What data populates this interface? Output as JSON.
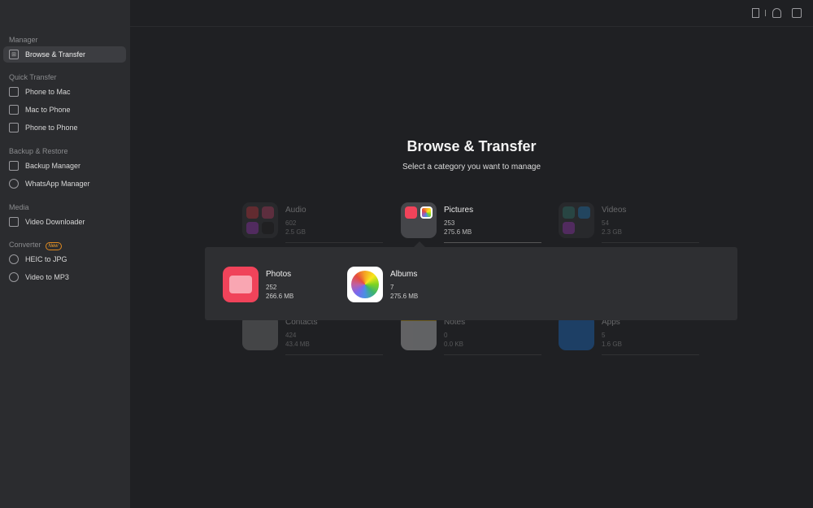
{
  "sidebar": {
    "sections": [
      {
        "label": "Manager",
        "items": [
          {
            "label": "Browse & Transfer",
            "icon": "grid-icon",
            "active": true
          }
        ]
      },
      {
        "label": "Quick Transfer",
        "items": [
          {
            "label": "Phone to Mac",
            "icon": "monitor-icon"
          },
          {
            "label": "Mac to Phone",
            "icon": "phone-icon"
          },
          {
            "label": "Phone to Phone",
            "icon": "phone-transfer-icon"
          }
        ]
      },
      {
        "label": "Backup & Restore",
        "items": [
          {
            "label": "Backup Manager",
            "icon": "backup-icon"
          },
          {
            "label": "WhatsApp Manager",
            "icon": "whatsapp-icon"
          }
        ]
      },
      {
        "label": "Media",
        "items": [
          {
            "label": "Video Downloader",
            "icon": "video-download-icon"
          }
        ]
      },
      {
        "label": "Converter",
        "badge": "New",
        "items": [
          {
            "label": "HEIC to JPG",
            "icon": "convert-image-icon"
          },
          {
            "label": "Video to MP3",
            "icon": "convert-video-icon"
          }
        ]
      }
    ]
  },
  "topbar": {
    "icons": [
      "device-icon",
      "bell-icon",
      "tshirt-icon"
    ]
  },
  "main": {
    "title": "Browse & Transfer",
    "subtitle": "Select a category you want to manage",
    "categories": [
      {
        "name": "Audio",
        "count": "602",
        "size": "2.5 GB"
      },
      {
        "name": "Pictures",
        "count": "253",
        "size": "275.6 MB"
      },
      {
        "name": "Videos",
        "count": "54",
        "size": "2.3 GB"
      },
      {
        "name": "Contacts",
        "count": "424",
        "size": "43.4 MB"
      },
      {
        "name": "Notes",
        "count": "0",
        "size": "0.0 KB"
      },
      {
        "name": "Apps",
        "count": "5",
        "size": "1.6 GB"
      }
    ],
    "popup": [
      {
        "name": "Photos",
        "count": "252",
        "size": "266.6 MB"
      },
      {
        "name": "Albums",
        "count": "7",
        "size": "275.6 MB"
      }
    ]
  },
  "colors": {
    "accent_new": "#e08a20",
    "photos_red": "#f0435a"
  }
}
